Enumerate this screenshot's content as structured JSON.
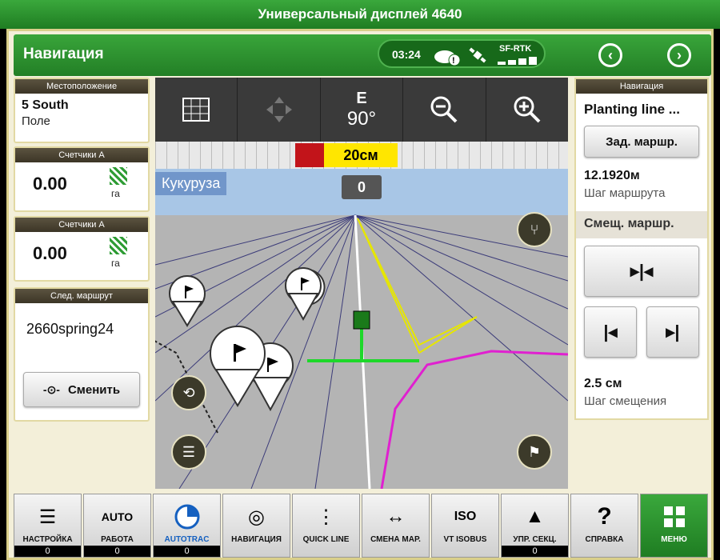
{
  "window": {
    "title": "Универсальный дисплей 4640"
  },
  "header": {
    "title": "Навигация",
    "time": "03:24",
    "rtk": "SF-RTK"
  },
  "left": {
    "location": {
      "caption": "Местоположение",
      "line1": "5 South",
      "line2": "Поле"
    },
    "counter1": {
      "caption": "Счетчики А",
      "value": "0.00",
      "unit": "га"
    },
    "counter2": {
      "caption": "Счетчики А",
      "value": "0.00",
      "unit": "га"
    },
    "route": {
      "caption": "След. маршрут",
      "name": "2660spring24",
      "change_label": "Сменить"
    }
  },
  "map": {
    "heading_dir": "E",
    "heading_deg": "90°",
    "offset": "20см",
    "crop": "Кукуруза",
    "track": "0"
  },
  "right": {
    "caption": "Навигация",
    "line_name": "Planting line ...",
    "set_track_label": "Зад. маршр.",
    "track_spacing": "12.1920м",
    "track_spacing_label": "Шаг маршрута",
    "shift_label": "Смещ. маршр.",
    "shift_step": "2.5 см",
    "shift_step_label": "Шаг смещения"
  },
  "bottom": [
    {
      "label": "НАСТРОЙКА",
      "counter": "0",
      "icon": "list-check-icon"
    },
    {
      "label": "РАБОТА",
      "counter": "0",
      "icon": "auto-icon",
      "top": "AUTO"
    },
    {
      "label": "AUTOTRAC",
      "counter": "0",
      "icon": "autotrac-icon"
    },
    {
      "label": "НАВИГАЦИЯ",
      "counter": "",
      "icon": "navigation-icon"
    },
    {
      "label": "QUICK LINE",
      "counter": "",
      "icon": "quick-line-icon"
    },
    {
      "label": "СМЕНА МАР.",
      "counter": "",
      "icon": "change-route-icon"
    },
    {
      "label": "VT ISOBUS",
      "counter": "",
      "icon": "isobus-icon"
    },
    {
      "label": "УПР. СЕКЦ.",
      "counter": "0",
      "icon": "section-control-icon"
    },
    {
      "label": "СПРАВКА",
      "counter": "",
      "icon": "help-icon"
    },
    {
      "label": "МЕНЮ",
      "counter": "",
      "icon": "menu-grid-icon"
    }
  ]
}
